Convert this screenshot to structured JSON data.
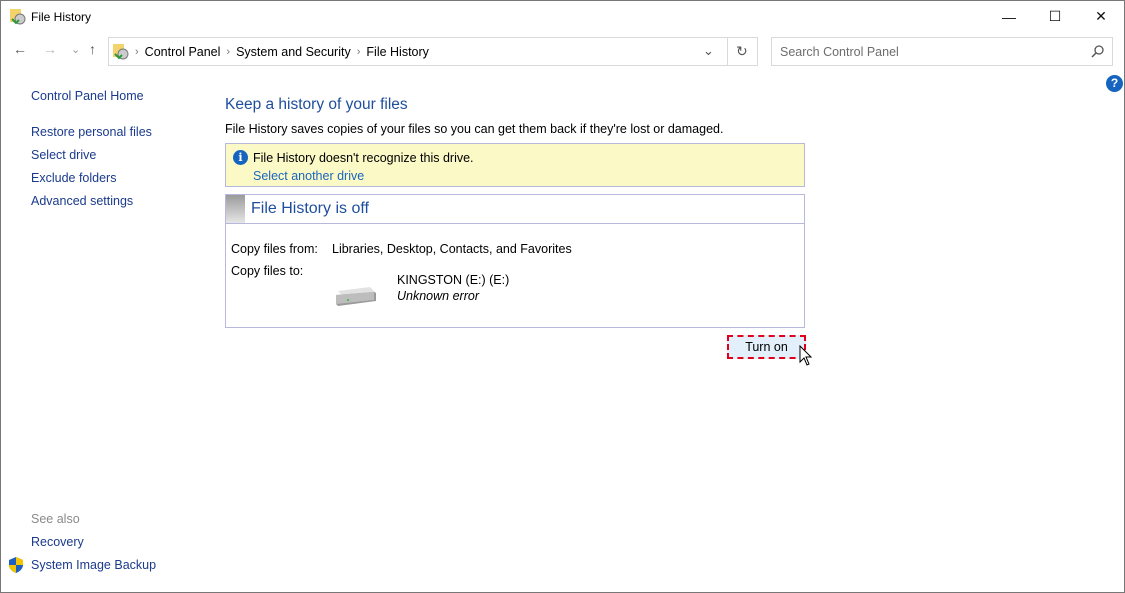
{
  "window": {
    "title": "File History",
    "minimize": "—",
    "maximize": "☐",
    "close": "✕"
  },
  "nav": {
    "back": "←",
    "forward": "→",
    "recent": "⌄",
    "up": "↑",
    "breadcrumb": [
      "Control Panel",
      "System and Security",
      "File History"
    ],
    "dropdown": "⌄",
    "refresh": "↻"
  },
  "search": {
    "placeholder": "Search Control Panel"
  },
  "help": "?",
  "sidebar": {
    "home": "Control Panel Home",
    "items": [
      "Restore personal files",
      "Select drive",
      "Exclude folders",
      "Advanced settings"
    ],
    "see_also": "See also",
    "see_also_items": [
      "Recovery",
      "System Image Backup"
    ]
  },
  "main": {
    "heading": "Keep a history of your files",
    "description": "File History saves copies of your files so you can get them back if they're lost or damaged.",
    "warning": {
      "message": "File History doesn't recognize this drive.",
      "link": "Select another drive"
    },
    "status": {
      "title": "File History is off",
      "copy_from_label": "Copy files from:",
      "copy_from_value": "Libraries, Desktop, Contacts, and Favorites",
      "copy_to_label": "Copy files to:",
      "drive_name": "KINGSTON (E:) (E:)",
      "drive_status": "Unknown error"
    },
    "turn_on": "Turn on"
  }
}
